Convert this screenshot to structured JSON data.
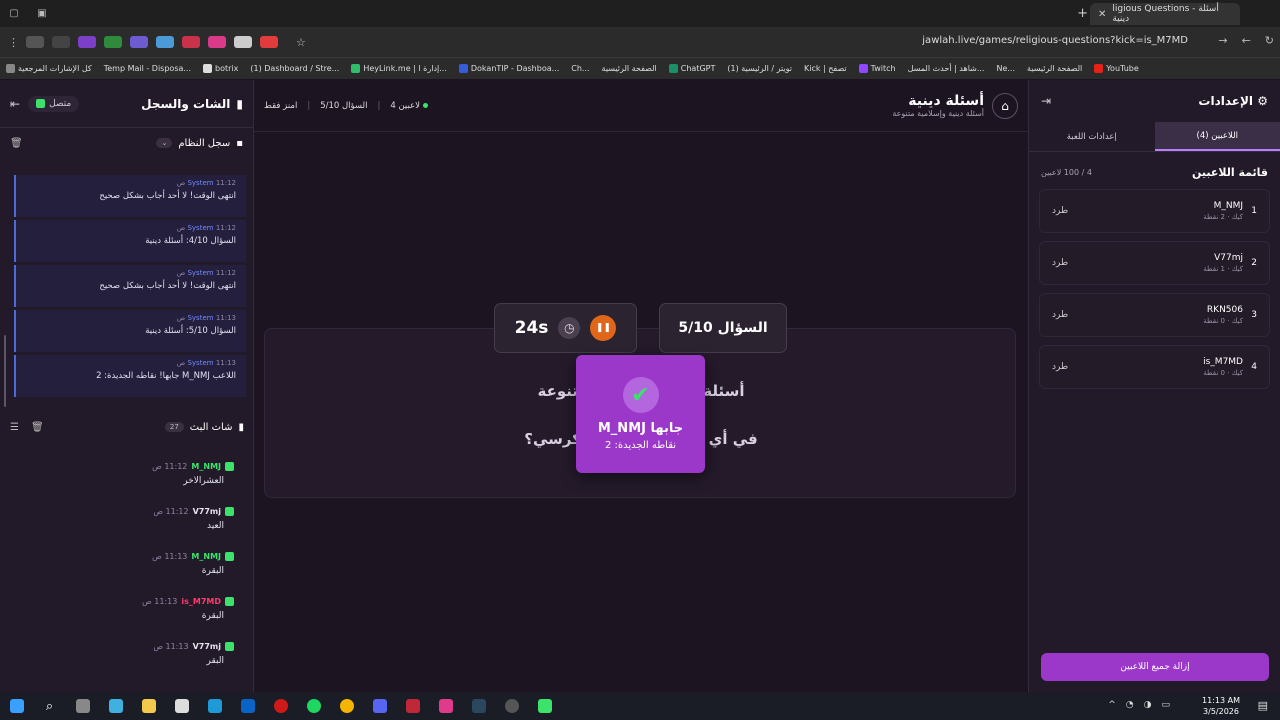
{
  "browser": {
    "tab_title": "ligious Questions - أسئلة دينية",
    "url": "jawlah.live/games/religious-questions?kick=is_M7MD",
    "bookmarks": [
      "كل الإشارات المرجعية",
      "Temp Mail - Disposa...",
      "botrix",
      "(1) Dashboard / Stre...",
      "HeyLink.me | إدارة ا...",
      "DokanTIP - Dashboa...",
      "Ch...",
      "الصفحة الرئيسية",
      "ChatGPT",
      "(1) تويتر / الرئيسية",
      "Kick | تصفح",
      "Twitch",
      "شاهد | أحدث المسل...",
      "Ne...",
      "الصفحة الرئيسية",
      "YouTube"
    ]
  },
  "chat_panel": {
    "title": "الشات والسجل",
    "status": "متصل",
    "system_log_title": "سجل النظام",
    "system_log": [
      {
        "sender": "System",
        "time": "11:12 ص",
        "text": "انتهى الوقت! لا أحد أجاب بشكل صحيح"
      },
      {
        "sender": "System",
        "time": "11:12 ص",
        "text": "السؤال 4/10: أسئلة دينية"
      },
      {
        "sender": "System",
        "time": "11:12 ص",
        "text": "انتهى الوقت! لا أحد أجاب بشكل صحيح"
      },
      {
        "sender": "System",
        "time": "11:13 ص",
        "text": "السؤال 5/10: أسئلة دينية"
      },
      {
        "sender": "System",
        "time": "11:13 ص",
        "text": "اللاعب M_NMJ جابها! نقاطه الجديدة: 2"
      }
    ],
    "live_chat_title": "شات البث",
    "live_chat_count": "27",
    "messages": [
      {
        "user": "M_NMJ",
        "time": "11:12 ص",
        "text": "العشرالاخر",
        "color": "#3be36b"
      },
      {
        "user": "V77mj",
        "time": "11:12 ص",
        "text": "العيد",
        "color": "#e8e4ee"
      },
      {
        "user": "M_NMJ",
        "time": "11:13 ص",
        "text": "البقرة",
        "color": "#3be36b"
      },
      {
        "user": "is_M7MD",
        "time": "11:13 ص",
        "text": "البقرة",
        "color": "#ff3b6b"
      },
      {
        "user": "V77mj",
        "time": "11:13 ص",
        "text": "البقر",
        "color": "#e8e4ee"
      }
    ]
  },
  "game": {
    "title": "أسئلة دينية",
    "subtitle": "أسئلة دينية وإسلامية متنوعة",
    "players_count": "4 لاعبين",
    "question_counter": "السؤال 5/10",
    "host_mode": "امنز فقط",
    "timer": "24s",
    "question_box_label": "السؤال 5/10",
    "category_text": "أسئلة دينية وإسلامية متنوعة",
    "question_text": "في أي سورة توجد آية الكرسي؟",
    "popup_title": "M_NMJ جابها",
    "popup_sub": "نقاطه الجديدة: 2"
  },
  "settings_panel": {
    "title": "الإعدادات",
    "tabs": [
      "اللاعبين (4)",
      "إعدادات اللعبة"
    ],
    "players_title": "قائمة اللاعبين",
    "players_capacity": "4 / 100 لاعبين",
    "kick_label": "طرد",
    "players": [
      {
        "rank": "1",
        "name": "M_NMJ",
        "sub": "كيك · 2 نقطة"
      },
      {
        "rank": "2",
        "name": "V77mj",
        "sub": "كيك · 1 نقطة"
      },
      {
        "rank": "3",
        "name": "RKN506",
        "sub": "كيك · 0 نقطة"
      },
      {
        "rank": "4",
        "name": "is_M7MD",
        "sub": "كيك · 0 نقطة"
      }
    ],
    "clear_button": "إزالة جميع اللاعبين"
  },
  "taskbar": {
    "time": "11:13 AM",
    "date": "3/5/2026"
  },
  "colors": {
    "accent_purple": "#9b38c9",
    "kick_green": "#3be36b",
    "timer_orange": "#e0661a"
  }
}
